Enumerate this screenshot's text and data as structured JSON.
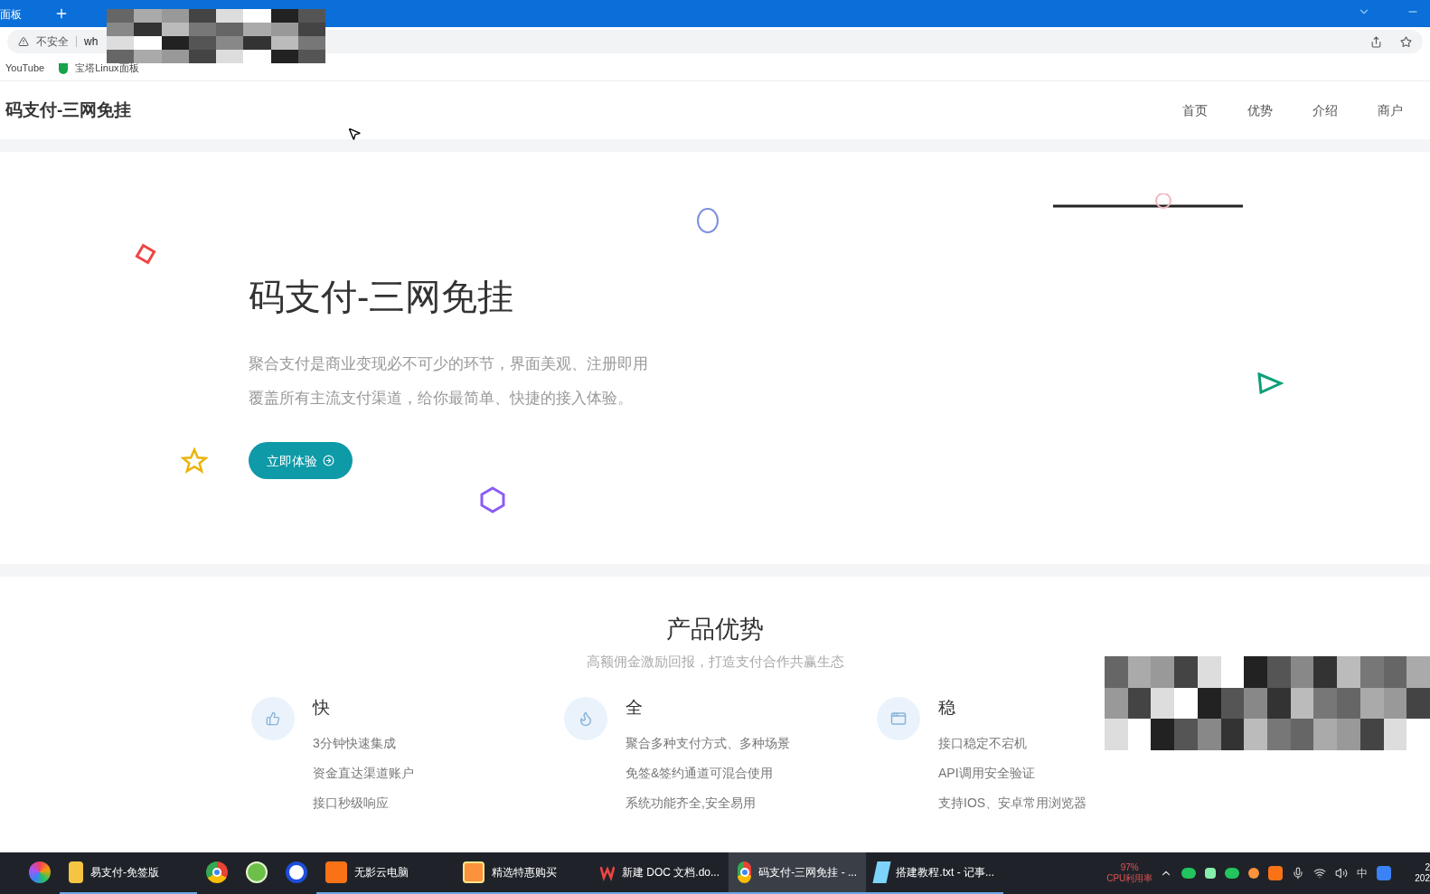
{
  "browser": {
    "tabs": [
      {
        "title": "面板",
        "selected": false
      }
    ],
    "address": {
      "security": "不安全",
      "url": "wh"
    },
    "bookmarks": [
      {
        "label": "YouTube",
        "kind": "text"
      },
      {
        "label": "宝塔Linux面板",
        "kind": "icon"
      }
    ]
  },
  "site": {
    "logo": "码支付-三网免挂",
    "nav": [
      {
        "label": "首页"
      },
      {
        "label": "优势"
      },
      {
        "label": "介绍"
      },
      {
        "label": "商户"
      }
    ]
  },
  "hero": {
    "title": "码支付-三网免挂",
    "lines": [
      "聚合支付是商业变现必不可少的环节，界面美观、注册即用",
      "覆盖所有主流支付渠道，给你最简单、快捷的接入体验。"
    ],
    "button": "立即体验"
  },
  "advantages": {
    "title": "产品优势",
    "subtitle": "高额佣金激励回报，打造支付合作共赢生态",
    "items": [
      {
        "kind": "thumb",
        "title": "快",
        "points": [
          "3分钟快速集成",
          "资金直达渠道账户",
          "接口秒级响应"
        ]
      },
      {
        "kind": "flame",
        "title": "全",
        "points": [
          "聚合多种支付方式、多种场景",
          "免签&签约通道可混合使用",
          "系统功能齐全,安全易用"
        ]
      },
      {
        "kind": "window",
        "title": "稳",
        "points": [
          "接口稳定不宕机",
          "API调用安全验证",
          "支持IOS、安卓常用浏览器"
        ]
      }
    ]
  },
  "taskbar": {
    "items": [
      {
        "kind": "colorwheel",
        "selected": false
      },
      {
        "kind": "folder",
        "label": "易支付-免签版",
        "selected": false
      },
      {
        "kind": "chrome",
        "selected": false
      },
      {
        "kind": "green",
        "selected": false
      },
      {
        "kind": "blue",
        "selected": false
      },
      {
        "kind": "orange",
        "label": "无影云电脑",
        "selected": false
      },
      {
        "kind": "shop",
        "label": "精选特惠购买",
        "selected": false
      },
      {
        "kind": "wps",
        "label": "新建 DOC 文档.do...",
        "selected": false
      },
      {
        "kind": "chrome",
        "label": "码支付-三网免挂 - ...",
        "selected": true
      },
      {
        "kind": "notepad",
        "label": "搭建教程.txt - 记事..."
      }
    ],
    "cpu": {
      "value": "97%",
      "label": "CPU利用率"
    },
    "ime": "中",
    "clock": [
      "2",
      "202"
    ]
  }
}
